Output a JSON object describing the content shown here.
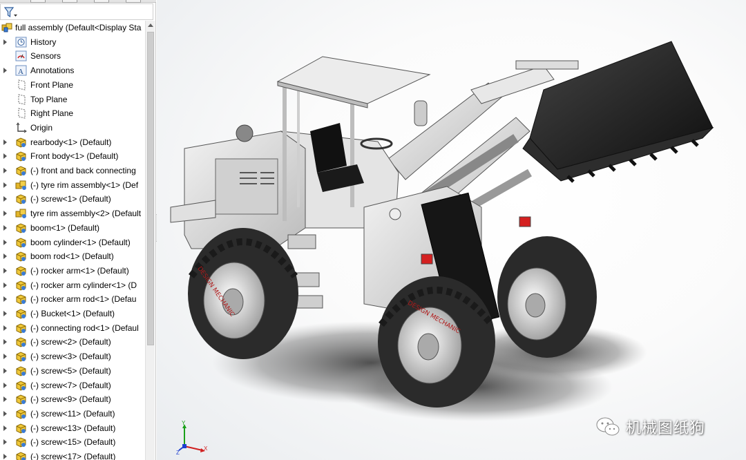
{
  "feature_tree": {
    "root": {
      "label": "full assembly  (Default<Display Sta",
      "icon": "assembly-icon"
    },
    "items": [
      {
        "label": "History",
        "icon": "history-icon",
        "expandable": true
      },
      {
        "label": "Sensors",
        "icon": "sensors-icon",
        "expandable": false
      },
      {
        "label": "Annotations",
        "icon": "annotations-icon",
        "expandable": true
      },
      {
        "label": "Front Plane",
        "icon": "plane-icon",
        "expandable": false
      },
      {
        "label": "Top Plane",
        "icon": "plane-icon",
        "expandable": false
      },
      {
        "label": "Right Plane",
        "icon": "plane-icon",
        "expandable": false
      },
      {
        "label": "Origin",
        "icon": "origin-icon",
        "expandable": false
      },
      {
        "label": "rearbody<1> (Default)",
        "icon": "part-icon",
        "expandable": true
      },
      {
        "label": "Front body<1> (Default)",
        "icon": "part-icon",
        "expandable": true
      },
      {
        "label": "(-) front and back connecting",
        "icon": "part-icon",
        "expandable": true
      },
      {
        "label": "(-) tyre rim assembly<1> (Def",
        "icon": "subassembly-icon",
        "expandable": true
      },
      {
        "label": "(-) screw<1> (Default)",
        "icon": "part-icon",
        "expandable": true
      },
      {
        "label": "tyre rim assembly<2> (Default",
        "icon": "subassembly-icon",
        "expandable": true
      },
      {
        "label": "boom<1> (Default)",
        "icon": "part-icon",
        "expandable": true
      },
      {
        "label": "boom cylinder<1> (Default)",
        "icon": "part-icon",
        "expandable": true
      },
      {
        "label": "boom rod<1> (Default)",
        "icon": "part-icon",
        "expandable": true
      },
      {
        "label": "(-) rocker arm<1> (Default)",
        "icon": "part-icon",
        "expandable": true
      },
      {
        "label": "(-) rocker arm cylinder<1> (D",
        "icon": "part-icon",
        "expandable": true
      },
      {
        "label": "(-) rocker arm rod<1> (Defau",
        "icon": "part-icon",
        "expandable": true
      },
      {
        "label": "(-) Bucket<1> (Default)",
        "icon": "part-icon",
        "expandable": true
      },
      {
        "label": "(-) connecting rod<1> (Defaul",
        "icon": "part-icon",
        "expandable": true
      },
      {
        "label": "(-) screw<2> (Default)",
        "icon": "part-icon",
        "expandable": true
      },
      {
        "label": "(-) screw<3> (Default)",
        "icon": "part-icon",
        "expandable": true
      },
      {
        "label": "(-) screw<5> (Default)",
        "icon": "part-icon",
        "expandable": true
      },
      {
        "label": "(-) screw<7> (Default)",
        "icon": "part-icon",
        "expandable": true
      },
      {
        "label": "(-) screw<9> (Default)",
        "icon": "part-icon",
        "expandable": true
      },
      {
        "label": "(-) screw<11> (Default)",
        "icon": "part-icon",
        "expandable": true
      },
      {
        "label": "(-) screw<13> (Default)",
        "icon": "part-icon",
        "expandable": true
      },
      {
        "label": "(-) screw<15> (Default)",
        "icon": "part-icon",
        "expandable": true
      },
      {
        "label": "(-) screw<17> (Default)",
        "icon": "part-icon",
        "expandable": true
      }
    ]
  },
  "viewport": {
    "model_name": "wheel loader",
    "triad_axes": [
      "Y",
      "X",
      "Z"
    ]
  },
  "watermark": {
    "text": "机械图纸狗",
    "icon": "wechat-icon"
  },
  "colors": {
    "panel_bg": "#ffffff",
    "part_icon": "#d6a81e",
    "tire": "#2a2a2a",
    "tire_text": "#b01818",
    "body": "#dcdcdc",
    "bucket": "#1f1f1f",
    "axis_x": "#d01f1f",
    "axis_y": "#1aa01a",
    "axis_z": "#1f3fd0"
  }
}
